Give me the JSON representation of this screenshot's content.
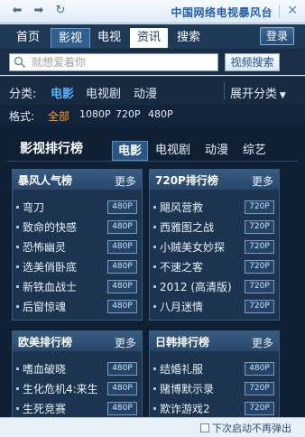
{
  "window": {
    "title": "中国网络电视暴风台"
  },
  "tabs": [
    {
      "label": "首页"
    },
    {
      "label": "影视"
    },
    {
      "label": "电视"
    },
    {
      "label": "资讯"
    },
    {
      "label": "搜索"
    }
  ],
  "login_label": "登录",
  "search": {
    "placeholder": "就想爱着你",
    "button_label": "视频搜索"
  },
  "category": {
    "label": "分类:",
    "items": [
      "电影",
      "电视剧",
      "动漫"
    ],
    "active": "电影",
    "expand_label": "展开分类"
  },
  "format": {
    "label": "格式:",
    "items": [
      "全部",
      "1080P",
      "720P",
      "480P"
    ],
    "active": "全部"
  },
  "ranking": {
    "title": "影视排行榜",
    "tabs": [
      "电影",
      "电视剧",
      "动漫",
      "综艺"
    ],
    "active_tab": "电影",
    "boxes": [
      {
        "title": "暴风人气榜",
        "more": "更多",
        "items": [
          {
            "name": "弯刀",
            "badge": "480P"
          },
          {
            "name": "致命的快感",
            "badge": "480P"
          },
          {
            "name": "恐怖幽灵",
            "badge": "480P"
          },
          {
            "name": "选美俏卧底",
            "badge": "480P"
          },
          {
            "name": "新铁血战士",
            "badge": "480P"
          },
          {
            "name": "后窗惊魂",
            "badge": "480P"
          }
        ]
      },
      {
        "title": "720P排行榜",
        "more": "更多",
        "items": [
          {
            "name": "飓风营救",
            "badge": "720P"
          },
          {
            "name": "西雅图之战",
            "badge": "720P"
          },
          {
            "name": "小贼美女妙探",
            "badge": "720P"
          },
          {
            "name": "不速之客",
            "badge": "720P"
          },
          {
            "name": "2012 (高清版)",
            "badge": "720P"
          },
          {
            "name": "八月迷情",
            "badge": "720P"
          }
        ]
      },
      {
        "title": "欧美排行榜",
        "more": "更多",
        "items": [
          {
            "name": "嗜血破晓",
            "badge": "480P"
          },
          {
            "name": "生化危机4:来生",
            "badge": "480P"
          },
          {
            "name": "生死竞赛",
            "badge": "480P"
          }
        ]
      },
      {
        "title": "日韩排行榜",
        "more": "更多",
        "items": [
          {
            "name": "结婚礼服",
            "badge": "480P"
          },
          {
            "name": "赌博默示录",
            "badge": "720P"
          },
          {
            "name": "欺诈游戏2",
            "badge": "720P"
          }
        ]
      }
    ]
  },
  "footer": {
    "checkbox_label": "下次启动不再弹出"
  }
}
